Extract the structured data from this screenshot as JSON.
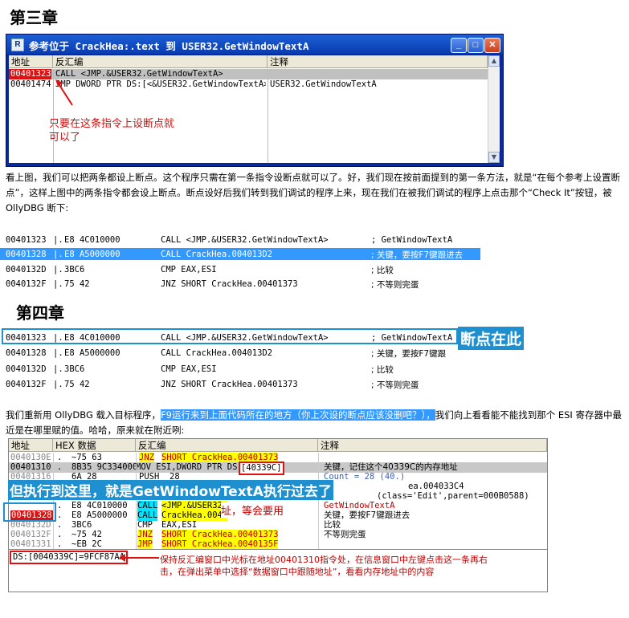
{
  "chapter3_title": "第三章",
  "chapter4_title": "第四章",
  "window": {
    "title": "参考位于 CrackHea:.text 到 USER32.GetWindowTextA",
    "icon_letter": "R",
    "col_address": "地址",
    "col_disasm": "反汇编",
    "col_comment": "注释",
    "rows": [
      {
        "addr": "00401323",
        "disasm": "CALL <JMP.&USER32.GetWindowTextA>",
        "comment": ""
      },
      {
        "addr": "00401474",
        "disasm": "JMP DWORD PTR DS:[<&USER32.GetWindowTextA>]",
        "comment": "USER32.GetWindowTextA"
      }
    ],
    "annotation": "只要在这条指令上设断点就\n可以了"
  },
  "paragraph1": "看上图，我们可以把两条都设上断点。这个程序只需在第一条指令设断点就可以了。好，我们现在按前面提到的第一条方法，就是“在每个参考上设置断点”，这样上图中的两条指令都会设上断点。断点设好后我们转到我们调试的程序上来，现在我们在被我们调试的程序上点击那个“Check It”按钮，被 OllyDBG 断下:",
  "listing1": [
    {
      "addr": "00401323",
      "sep": "|.",
      "bytes": "E8 4C010000",
      "instr": "CALL <JMP.&USER32.GetWindowTextA>",
      "comment": "; GetWindowTextA"
    },
    {
      "addr": "00401328",
      "sep": "|.",
      "bytes": "E8 A5000000",
      "instr": "CALL CrackHea.004013D2",
      "comment": "; 关键，要按F7键跟进去"
    },
    {
      "addr": "0040132D",
      "sep": "|.",
      "bytes": "3BC6",
      "instr": "CMP EAX,ESI",
      "comment": "; 比较"
    },
    {
      "addr": "0040132F",
      "sep": "|.",
      "bytes": "75 42",
      "instr": "JNZ SHORT CrackHea.00401373",
      "comment": "; 不等则完蛋"
    }
  ],
  "listing2": [
    {
      "addr": "00401323",
      "sep": "|.",
      "bytes": "E8 4C010000",
      "instr": "CALL <JMP.&USER32.GetWindowTextA>",
      "comment": "; GetWindowTextA"
    },
    {
      "addr": "00401328",
      "sep": "|.",
      "bytes": "E8 A5000000",
      "instr": "CALL CrackHea.004013D2",
      "comment": "; 关键，要按F7键跟"
    },
    {
      "addr": "0040132D",
      "sep": "|.",
      "bytes": "3BC6",
      "instr": "CMP EAX,ESI",
      "comment": "; 比较"
    },
    {
      "addr": "0040132F",
      "sep": "|.",
      "bytes": "75 42",
      "instr": "JNZ SHORT CrackHea.00401373",
      "comment": "; 不等则完蛋"
    }
  ],
  "breakpoint_label": "断点在此",
  "paragraph2_pre": "我们重新用 OllyDBG 载入目标程序，",
  "paragraph2_hl": "F9运行来到上面代码所在的地方（你上次设的断点应该没删吧？），",
  "paragraph2_post": "我们向上看看能不能找到那个 ESI 寄存器中最近是在哪里赋的值。哈哈，原来就在附近咧:",
  "cpu": {
    "col_address": "地址",
    "col_hex": "HEX 数据",
    "col_disasm": "反汇编",
    "col_comment": "注释",
    "rows": [
      {
        "addr": "0040130E",
        "sep": ".",
        "hex": "~75 63",
        "op": "JNZ",
        "arg": "SHORT CrackHea.00401373",
        "comment": ""
      },
      {
        "addr": "00401310",
        "sep": ".",
        "hex": "8B35 9C334000",
        "op": "MOV ESI,DWORD PTR DS:",
        "arg": "[40339C]",
        "comment": "关键，记住这个40339C的内存地址"
      },
      {
        "addr": "00401316",
        "sep": ".",
        "hex": "6A 28",
        "op": "PUSH",
        "arg": "28",
        "comment": "Count = 28 (40.)"
      },
      {
        "addr": "00401323",
        "sep": ".",
        "hex": "E8 4C010000",
        "op": "CALL",
        "arg": "<JMP.&USER32.",
        "comment": "GetWindowTextA"
      },
      {
        "addr": "00401328",
        "sep": ".",
        "hex": "E8 A5000000",
        "op": "CALL",
        "arg": "CrackHea.0040",
        "comment": "关键，要按F7键跟进去"
      },
      {
        "addr": "0040132D",
        "sep": ".",
        "hex": "3BC6",
        "op": "CMP",
        "arg": "EAX,ESI",
        "comment": "比较"
      },
      {
        "addr": "0040132F",
        "sep": ".",
        "hex": "~75 42",
        "op": "JNZ",
        "arg": "SHORT CrackHea.00401373",
        "comment": "不等则完蛋"
      },
      {
        "addr": "00401331",
        "sep": ".",
        "hex": "~EB 2C",
        "op": "JMP",
        "arg": "SHORT CrackHea.0040135F",
        "comment": ""
      }
    ],
    "comment_extra1": "ea.004033C4",
    "comment_extra2": "(class='Edit',parent=000B0588)",
    "info_line": "DS:[0040339C]=9FCF87AA",
    "blue_banner": "但执行到这里，就是GetWindowTextA执行过去了",
    "red_note": "址，等会要用",
    "bottom_note": "保持反汇编窗口中光标在地址00401310指令处，在信息窗口中左键点击这一条再右击，在弹出菜单中选择“数据窗口中跟随地址”，看看内存地址中的内容"
  }
}
